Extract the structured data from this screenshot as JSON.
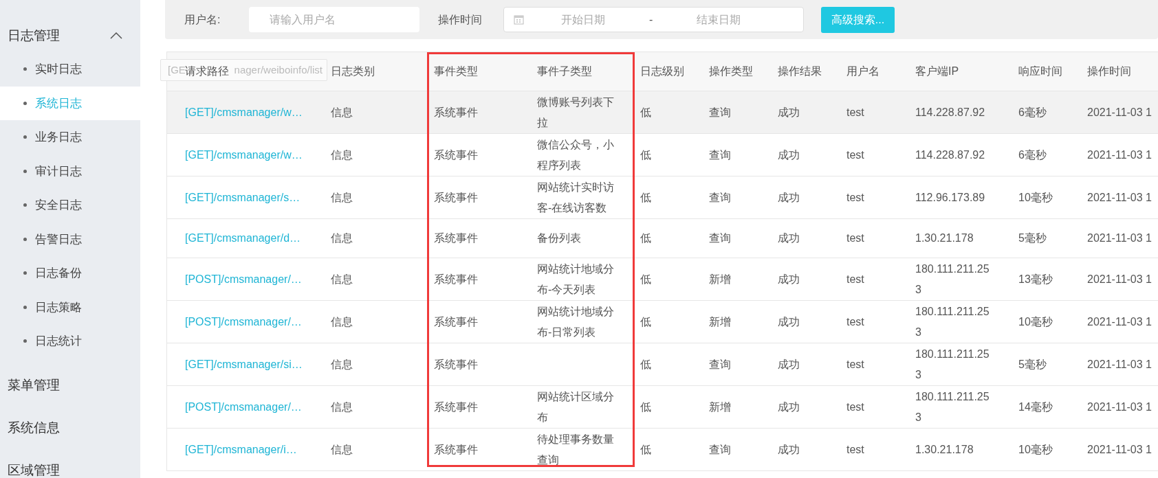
{
  "sidebar": {
    "groups": [
      {
        "label": "日志管理",
        "expanded": true,
        "children": [
          {
            "label": "实时日志",
            "selected": false
          },
          {
            "label": "系统日志",
            "selected": true
          },
          {
            "label": "业务日志",
            "selected": false
          },
          {
            "label": "审计日志",
            "selected": false
          },
          {
            "label": "安全日志",
            "selected": false
          },
          {
            "label": "告警日志",
            "selected": false
          },
          {
            "label": "日志备份",
            "selected": false
          },
          {
            "label": "日志策略",
            "selected": false
          },
          {
            "label": "日志统计",
            "selected": false
          }
        ]
      },
      {
        "label": "菜单管理",
        "expanded": false
      },
      {
        "label": "系统信息",
        "expanded": false
      },
      {
        "label": "区域管理",
        "expanded": false
      }
    ]
  },
  "search": {
    "username_label": "用户名:",
    "username_placeholder": "请输入用户名",
    "time_label": "操作时间",
    "start_placeholder": "开始日期",
    "range_separator": "-",
    "end_placeholder": "结束日期",
    "button": "高级搜索..."
  },
  "tooltip": {
    "text_start": "[GE",
    "text_end": "nager/weiboinfo/list"
  },
  "table": {
    "columns": [
      "请求路径",
      "日志类别",
      "事件类型",
      "事件子类型",
      "日志级别",
      "操作类型",
      "操作结果",
      "用户名",
      "客户端IP",
      "响应时间",
      "操作时间"
    ],
    "rows": [
      {
        "highlighted": true,
        "cells": [
          "[GET]/cmsmanager/w…",
          "信息",
          "系统事件",
          "微博账号列表下拉",
          "低",
          "查询",
          "成功",
          "test",
          "114.228.87.92",
          "6毫秒",
          "2021-11-03 1"
        ]
      },
      {
        "highlighted": false,
        "cells": [
          "[GET]/cmsmanager/w…",
          "信息",
          "系统事件",
          "微信公众号，小程序列表",
          "低",
          "查询",
          "成功",
          "test",
          "114.228.87.92",
          "6毫秒",
          "2021-11-03 1"
        ]
      },
      {
        "highlighted": false,
        "cells": [
          "[GET]/cmsmanager/s…",
          "信息",
          "系统事件",
          "网站统计实时访客-在线访客数",
          "低",
          "查询",
          "成功",
          "test",
          "112.96.173.89",
          "10毫秒",
          "2021-11-03 1"
        ]
      },
      {
        "highlighted": false,
        "cells": [
          "[GET]/cmsmanager/d…",
          "信息",
          "系统事件",
          "备份列表",
          "低",
          "查询",
          "成功",
          "test",
          "1.30.21.178",
          "5毫秒",
          "2021-11-03 1"
        ]
      },
      {
        "highlighted": false,
        "cells": [
          "[POST]/cmsmanager/…",
          "信息",
          "系统事件",
          "网站统计地域分布-今天列表",
          "低",
          "新增",
          "成功",
          "test",
          "180.111.211.253",
          "13毫秒",
          "2021-11-03 1"
        ]
      },
      {
        "highlighted": false,
        "cells": [
          "[POST]/cmsmanager/…",
          "信息",
          "系统事件",
          "网站统计地域分布-日常列表",
          "低",
          "新增",
          "成功",
          "test",
          "180.111.211.253",
          "10毫秒",
          "2021-11-03 1"
        ]
      },
      {
        "highlighted": false,
        "cells": [
          "[GET]/cmsmanager/si…",
          "信息",
          "系统事件",
          "",
          "低",
          "查询",
          "成功",
          "test",
          "180.111.211.253",
          "5毫秒",
          "2021-11-03 1"
        ]
      },
      {
        "highlighted": false,
        "cells": [
          "[POST]/cmsmanager/…",
          "信息",
          "系统事件",
          "网站统计区域分布",
          "低",
          "新增",
          "成功",
          "test",
          "180.111.211.253",
          "14毫秒",
          "2021-11-03 1"
        ]
      },
      {
        "highlighted": false,
        "cells": [
          "[GET]/cmsmanager/i…",
          "信息",
          "系统事件",
          "待处理事务数量查询",
          "低",
          "查询",
          "成功",
          "test",
          "1.30.21.178",
          "10毫秒",
          "2021-11-03 1"
        ]
      }
    ]
  }
}
